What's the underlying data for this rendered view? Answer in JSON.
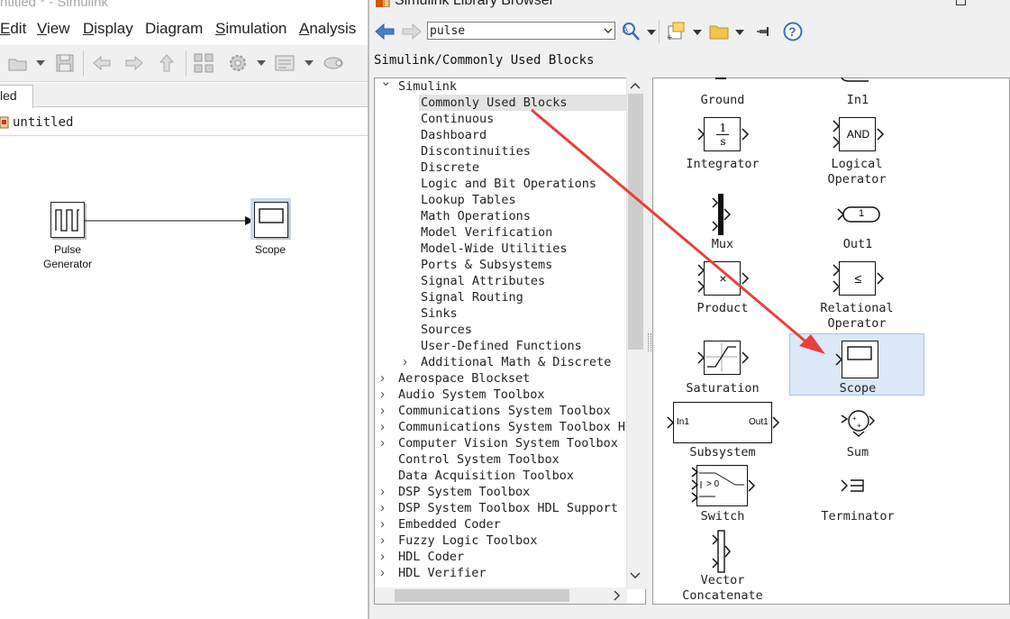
{
  "model_window": {
    "title": "ntitled * - Simulink",
    "menu": [
      "Edit",
      "View",
      "Display",
      "Diagram",
      "Simulation",
      "Analysis"
    ],
    "menu_underline": [
      "E",
      "V",
      "D",
      "g",
      "S",
      "A"
    ],
    "tab_label": "led",
    "breadcrumb": "untitled",
    "blocks": {
      "pulse_label": "Pulse\nGenerator",
      "scope_label": "Scope"
    }
  },
  "library_browser": {
    "title": "Simulink Library Browser",
    "search_value": "pulse",
    "path": "Simulink/Commonly Used Blocks",
    "tree": {
      "root": "Simulink",
      "children": [
        "Commonly Used Blocks",
        "Continuous",
        "Dashboard",
        "Discontinuities",
        "Discrete",
        "Logic and Bit Operations",
        "Lookup Tables",
        "Math Operations",
        "Model Verification",
        "Model-Wide Utilities",
        "Ports & Subsystems",
        "Signal Attributes",
        "Signal Routing",
        "Sinks",
        "Sources",
        "User-Defined Functions",
        "Additional Math & Discrete"
      ],
      "toolboxes": [
        "Aerospace Blockset",
        "Audio System Toolbox",
        "Communications System Toolbox",
        "Communications System Toolbox HDL",
        "Computer Vision System Toolbox",
        "Control System Toolbox",
        "Data Acquisition Toolbox",
        "DSP System Toolbox",
        "DSP System Toolbox HDL Support",
        "Embedded Coder",
        "Fuzzy Logic Toolbox",
        "HDL Coder",
        "HDL Verifier"
      ]
    },
    "blocks": {
      "ground": "Ground",
      "in1": "In1",
      "integrator": "Integrator",
      "integrator_num": "1",
      "integrator_den": "s",
      "logical_operator": "Logical\nOperator",
      "logical_and": "AND",
      "mux": "Mux",
      "out1": "Out1",
      "out1_num": "1",
      "product": "Product",
      "product_sym": "×",
      "relational_operator": "Relational\nOperator",
      "relational_sym": "≤",
      "saturation": "Saturation",
      "scope": "Scope",
      "subsystem": "Subsystem",
      "subsystem_in": "In1",
      "subsystem_out": "Out1",
      "sum": "Sum",
      "switch": "Switch",
      "switch_sym": "> 0",
      "terminator": "Terminator",
      "vector_concatenate": "Vector\nConcatenate"
    }
  },
  "annotation": {
    "arrow_color": "#e8413a"
  },
  "colors": {
    "selection_highlight": "#dce8f6",
    "tree_selected": "#e3e3e3"
  }
}
